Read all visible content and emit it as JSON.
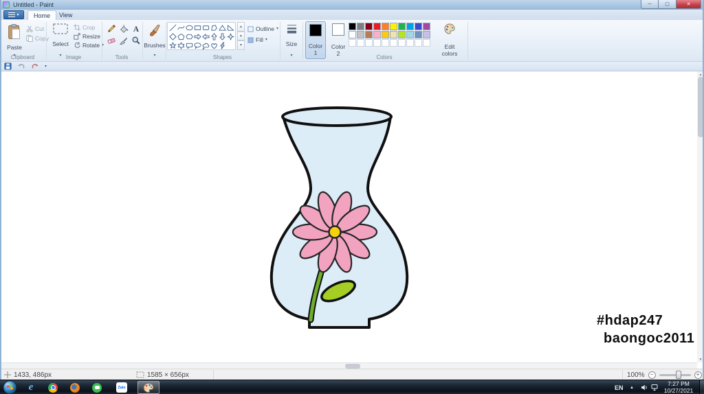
{
  "titlebar": {
    "title": "Untitled - Paint"
  },
  "icons": {
    "dropdown": "▾",
    "up_arrow": "▲",
    "down_arrow": "▼",
    "minimize": "─",
    "maximize": "▢",
    "close": "✕",
    "minus": "−",
    "plus": "+"
  },
  "tabs": {
    "home": "Home",
    "view": "View"
  },
  "ribbon": {
    "clipboard": {
      "group": "Clipboard",
      "paste": "Paste",
      "cut": "Cut",
      "copy": "Copy"
    },
    "image": {
      "group": "Image",
      "select": "Select",
      "crop": "Crop",
      "resize": "Resize",
      "rotate": "Rotate"
    },
    "tools": {
      "group": "Tools",
      "items": [
        "pencil",
        "fill-with-color",
        "text",
        "eraser",
        "color-picker",
        "magnifier"
      ]
    },
    "brushes": {
      "label": "Brushes"
    },
    "shapes": {
      "group": "Shapes",
      "outline": "Outline",
      "fill": "Fill",
      "items": [
        "line",
        "curve",
        "oval",
        "rectangle",
        "rounded-rectangle",
        "polygon",
        "triangle",
        "right-triangle",
        "diamond",
        "pentagon",
        "hexagon",
        "arrow-right",
        "arrow-left",
        "arrow-up",
        "arrow-down",
        "four-point-star",
        "five-point-star",
        "six-point-star",
        "rectangular-callout",
        "oval-callout",
        "cloud-callout",
        "heart",
        "lightning"
      ]
    },
    "size": {
      "label": "Size"
    },
    "colors": {
      "group": "Colors",
      "color1_label": "Color 1",
      "color2_label": "Color 2",
      "edit_label": "Edit colors",
      "color1": "#000000",
      "color2": "#FFFFFF",
      "palette": [
        [
          "#000000",
          "#7F7F7F",
          "#880015",
          "#ED1C24",
          "#FF7F27",
          "#FFF200",
          "#22B14C",
          "#00A2E8",
          "#3F48CC",
          "#A349A4"
        ],
        [
          "#FFFFFF",
          "#C3C3C3",
          "#B97A57",
          "#FFAEC9",
          "#FFC90E",
          "#EFE4B0",
          "#B5E61D",
          "#99D9EA",
          "#7092BE",
          "#C8BFE7"
        ],
        [
          "",
          "",
          "",
          "",
          "",
          "",
          "",
          "",
          "",
          ""
        ]
      ]
    }
  },
  "canvas": {
    "text1": "#hdap247",
    "text2": "baongoc2011",
    "colors": {
      "vase_fill": "#DCEDF8",
      "outline": "#101010",
      "petal": "#F2A3C0",
      "petal_stroke": "#262626",
      "center": "#F5D112",
      "stem": "#6FAE2C",
      "leaf": "#A4CE23"
    }
  },
  "statusbar": {
    "cursor": "1433, 486px",
    "selection": "1585 × 656px",
    "zoom": "100%"
  },
  "taskbar": {
    "zalo_label": "Zalo",
    "language": "EN",
    "time": "7:27 PM",
    "date": "10/27/2021"
  }
}
